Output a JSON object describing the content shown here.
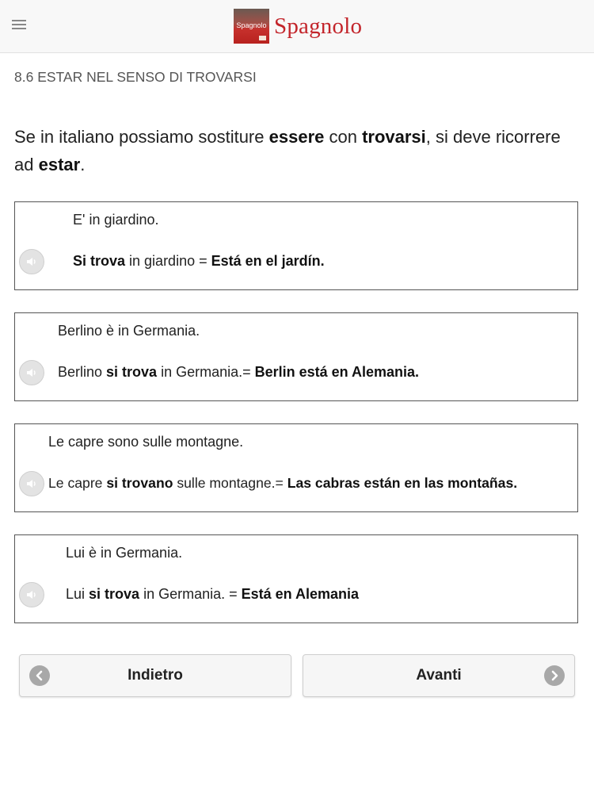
{
  "header": {
    "menu_icon": "hamburger-menu-icon",
    "logo_text": "Spagnolo",
    "title": "Spagnolo",
    "brand_color": "#c3252b"
  },
  "section_title": "8.6 ESTAR NEL SENSO DI TROVARSI",
  "intro": {
    "p1": "Se in italiano possiamo sostiture ",
    "b1": "essere",
    "p2": " con ",
    "b2": "trovarsi",
    "p3": ", si deve ricorrere ad ",
    "b3": "estar",
    "p4": "."
  },
  "examples": [
    {
      "sentence": "E' in giardino.",
      "t1": "",
      "b1": "Si trova",
      "t2": " in giardino = ",
      "b2": "Está en el jardín.",
      "audio_icon": "speaker-icon"
    },
    {
      "sentence": "Berlino è in Germania.",
      "t1": "Berlino ",
      "b1": "si trova",
      "t2": " in Germania.= ",
      "b2": "Berlin está en Alemania.",
      "audio_icon": "speaker-icon"
    },
    {
      "sentence": "Le capre sono sulle montagne.",
      "t1": "Le capre ",
      "b1": "si trovano",
      "t2": " sulle montagne.= ",
      "b2": "Las cabras están en las montañas.",
      "audio_icon": "speaker-icon"
    },
    {
      "sentence": "Lui è in Germania.",
      "t1": "Lui ",
      "b1": "si trova",
      "t2": " in Germania. = ",
      "b2": "Está en Alemania",
      "audio_icon": "speaker-icon"
    }
  ],
  "nav": {
    "back_label": "Indietro",
    "next_label": "Avanti",
    "back_icon": "arrow-left-circle-icon",
    "next_icon": "arrow-right-circle-icon"
  }
}
